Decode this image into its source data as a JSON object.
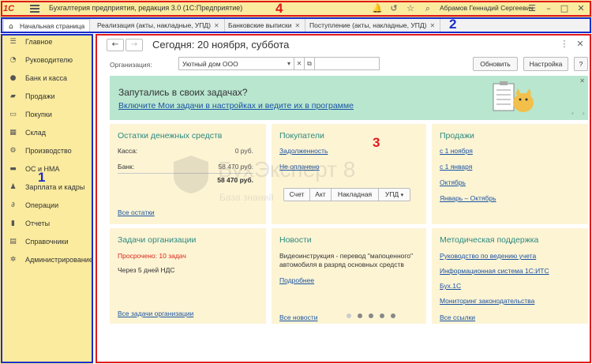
{
  "titlebar": {
    "app_title": "Бухгалтерия предприятия, редакция 3.0  (1С:Предприятие)",
    "user_name": "Абрамов Геннадий Сергеевич",
    "logo_text": "1С"
  },
  "tabs": [
    {
      "label": "Начальная страница"
    },
    {
      "label": "Реализация (акты, накладные, УПД)"
    },
    {
      "label": "Банковские выписки"
    },
    {
      "label": "Поступление (акты, накладные, УПД)"
    }
  ],
  "sidebar": {
    "items": [
      {
        "label": "Главное",
        "icon": "menu-icon"
      },
      {
        "label": "Руководителю",
        "icon": "chart-icon"
      },
      {
        "label": "Банк и касса",
        "icon": "coin-icon"
      },
      {
        "label": "Продажи",
        "icon": "bag-icon"
      },
      {
        "label": "Покупки",
        "icon": "basket-icon"
      },
      {
        "label": "Склад",
        "icon": "warehouse-icon"
      },
      {
        "label": "Производство",
        "icon": "factory-icon"
      },
      {
        "label": "ОС и НМА",
        "icon": "truck-icon"
      },
      {
        "label": "Зарплата и кадры",
        "icon": "person-icon"
      },
      {
        "label": "Операции",
        "icon": "operations-icon"
      },
      {
        "label": "Отчеты",
        "icon": "report-icon"
      },
      {
        "label": "Справочники",
        "icon": "books-icon"
      },
      {
        "label": "Администрирование",
        "icon": "gear-icon"
      }
    ]
  },
  "main": {
    "today": "Сегодня: 20 ноября, суббота",
    "org_label": "Организация:",
    "org_value": "Уютный дом ООО",
    "refresh_label": "Обновить",
    "settings_label": "Настройка",
    "help_label": "?",
    "banner": {
      "title": "Запутались в своих задачах?",
      "link": "Включите Мои задачи в настройках и ведите их в программе"
    },
    "cash": {
      "title": "Остатки денежных средств",
      "cash_label": "Касса:",
      "cash_value": "0 руб.",
      "bank_label": "Банк:",
      "bank_value": "58 470 руб.",
      "total_value": "58 470 руб.",
      "all_link": "Все остатки"
    },
    "buyers": {
      "title": "Покупатели",
      "debt_link": "Задолженность",
      "unpaid_link": "Не оплачено",
      "doc_buttons": [
        "Счет",
        "Акт",
        "Накладная",
        "УПД"
      ]
    },
    "sales": {
      "title": "Продажи",
      "links": [
        "с 1 ноября",
        "с 1 января",
        "Октябрь",
        "Январь – Октябрь"
      ]
    },
    "tasks": {
      "title": "Задачи организации",
      "overdue": "Просрочено:  10 задач",
      "vat": "Через 5 дней НДС",
      "all_link": "Все задачи организации"
    },
    "news": {
      "title": "Новости",
      "text_line1": "Видеоинструкция - перевод \"мапоценного\"",
      "text_line2": "автомобиля в разряд основных средств",
      "more_link": "Подробнее",
      "all_link": "Все новости"
    },
    "support": {
      "title": "Методическая поддержка",
      "links": [
        "Руководство по ведению учета",
        "Информационная система 1С:ИТС",
        "Бух.1С",
        "Мониторинг законодательства"
      ],
      "all_link": "Все ссылки"
    },
    "watermark": {
      "text": "БухЭксперт 8",
      "sub": "База знаний"
    }
  },
  "annotations": {
    "labels": [
      "1",
      "2",
      "3",
      "4"
    ],
    "colors": {
      "blue": "#1a2ec9",
      "red": "#e01a1a"
    }
  },
  "colors": {
    "sidebar_bg": "#fbeb9e",
    "banner_bg": "#b8e6cf",
    "card_bg": "#fdf4d4",
    "card_title": "#2a8a7e",
    "link": "#1a54a3",
    "overdue": "#d9261c"
  }
}
